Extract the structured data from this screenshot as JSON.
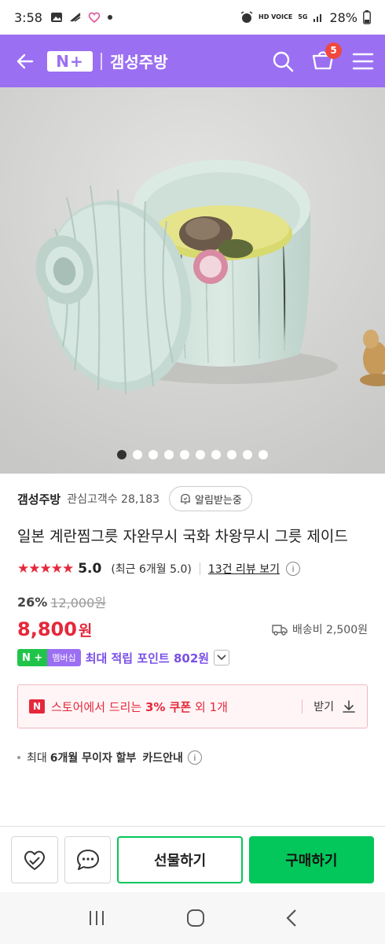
{
  "status_bar": {
    "time": "3:58",
    "notification_icons": [
      "image-icon",
      "wifi-calling-icon",
      "heart-icon",
      "dot-icon"
    ],
    "hd_voice": "HD VOICE",
    "network": "5G",
    "battery": "28%"
  },
  "app_bar": {
    "logo_text": "N+",
    "store_name": "갬성주방",
    "cart_count": "5"
  },
  "gallery": {
    "image_count": 10,
    "active_index": 0
  },
  "seller": {
    "name": "갬성주방",
    "fans_label": "관심고객수 28,183",
    "alarm_label": "알림받는중"
  },
  "product": {
    "title": "일본 계란찜그릇 자완무시 국화 차왕무시 그릇 제이드",
    "stars": "★★★★★",
    "score": "5.0",
    "recent_score": "(최근 6개월 5.0)",
    "reviews_label": "13건 리뷰 보기",
    "discount": "26%",
    "original_price": "12,000원",
    "price": "8,800",
    "currency": "원",
    "shipping": "배송비 2,500원"
  },
  "membership": {
    "badge_n": "N +",
    "badge_label": "멤버십",
    "text": "최대 적립 포인트 802원"
  },
  "coupon": {
    "badge": "N",
    "text_pre": "스토어에서 드리는 ",
    "text_bold": "3% 쿠폰",
    "text_post": " 외 1개",
    "action": "받기"
  },
  "installment": {
    "pre": "최대",
    "bold": "6개월 무이자 할부",
    "post": "카드안내"
  },
  "bottom_bar": {
    "gift_label": "선물하기",
    "buy_label": "구매하기"
  },
  "colors": {
    "header": "#9b6ff2",
    "price_red": "#e5283b",
    "naver_green": "#03c75a"
  }
}
